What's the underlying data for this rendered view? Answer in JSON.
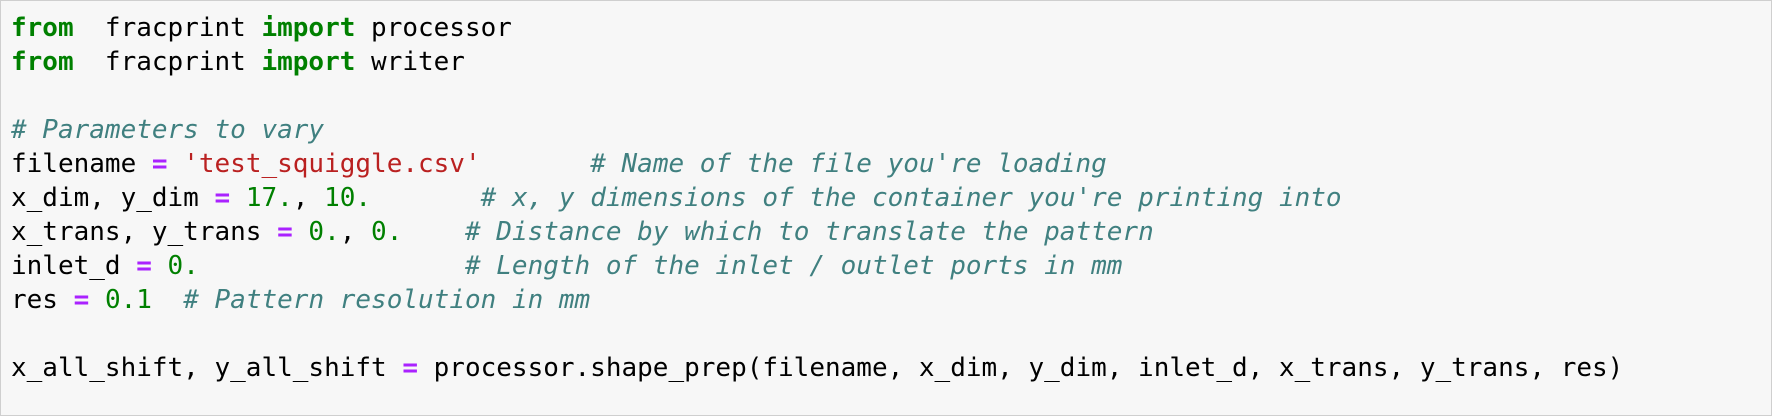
{
  "code": {
    "lines": [
      {
        "tokens": [
          [
            "kw",
            "from"
          ],
          [
            "",
            "  fracprint "
          ],
          [
            "kw",
            "import"
          ],
          [
            "",
            " processor"
          ]
        ]
      },
      {
        "tokens": [
          [
            "kw",
            "from"
          ],
          [
            "",
            "  fracprint "
          ],
          [
            "kw",
            "import"
          ],
          [
            "",
            " writer"
          ]
        ]
      },
      {
        "tokens": []
      },
      {
        "tokens": [
          [
            "com",
            "# Parameters to vary"
          ]
        ]
      },
      {
        "tokens": [
          [
            "",
            "filename "
          ],
          [
            "op",
            "="
          ],
          [
            "",
            " "
          ],
          [
            "str",
            "'test_squiggle.csv'"
          ],
          [
            "",
            "       "
          ],
          [
            "com",
            "# Name of the file you're loading"
          ]
        ]
      },
      {
        "tokens": [
          [
            "",
            "x_dim, y_dim "
          ],
          [
            "op",
            "="
          ],
          [
            "",
            " "
          ],
          [
            "num",
            "17."
          ],
          [
            "",
            ", "
          ],
          [
            "num",
            "10."
          ],
          [
            "",
            "       "
          ],
          [
            "com",
            "# x, y dimensions of the container you're printing into"
          ]
        ]
      },
      {
        "tokens": [
          [
            "",
            "x_trans, y_trans "
          ],
          [
            "op",
            "="
          ],
          [
            "",
            " "
          ],
          [
            "num",
            "0."
          ],
          [
            "",
            ", "
          ],
          [
            "num",
            "0."
          ],
          [
            "",
            "    "
          ],
          [
            "com",
            "# Distance by which to translate the pattern"
          ]
        ]
      },
      {
        "tokens": [
          [
            "",
            "inlet_d "
          ],
          [
            "op",
            "="
          ],
          [
            "",
            " "
          ],
          [
            "num",
            "0."
          ],
          [
            "",
            "                 "
          ],
          [
            "com",
            "# Length of the inlet / outlet ports in mm"
          ]
        ]
      },
      {
        "tokens": [
          [
            "",
            "res "
          ],
          [
            "op",
            "="
          ],
          [
            "",
            " "
          ],
          [
            "num",
            "0.1"
          ],
          [
            "",
            "  "
          ],
          [
            "com",
            "# Pattern resolution in mm"
          ]
        ]
      },
      {
        "tokens": []
      },
      {
        "tokens": [
          [
            "",
            "x_all_shift, y_all_shift "
          ],
          [
            "op",
            "="
          ],
          [
            "",
            " processor.shape_prep(filename, x_dim, y_dim, inlet_d, x_trans, y_trans, res)"
          ]
        ]
      }
    ]
  }
}
